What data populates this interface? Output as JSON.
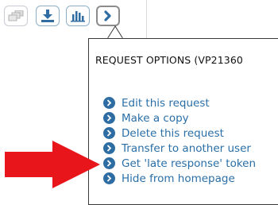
{
  "toolbar": {
    "buttons": [
      {
        "name": "copy-stack",
        "icon": "stacked-documents-icon",
        "state": "disabled"
      },
      {
        "name": "download",
        "icon": "download-icon",
        "state": "normal"
      },
      {
        "name": "statistics",
        "icon": "bar-chart-icon",
        "state": "normal"
      },
      {
        "name": "more-options",
        "icon": "chevron-right-icon",
        "state": "active"
      }
    ]
  },
  "popup": {
    "title": "REQUEST OPTIONS (VP21360",
    "items": [
      {
        "label": "Edit this request"
      },
      {
        "label": "Make a copy"
      },
      {
        "label": "Delete this request"
      },
      {
        "label": "Transfer to another user"
      },
      {
        "label": "Get 'late response' token"
      },
      {
        "label": "Hide from homepage"
      }
    ]
  },
  "annotation": {
    "color": "#e8161b",
    "points_to_item": 4
  },
  "colors": {
    "link": "#2a6fa8",
    "bullet": "#2e6da4",
    "toolbar_icon": "#2f6da3"
  }
}
